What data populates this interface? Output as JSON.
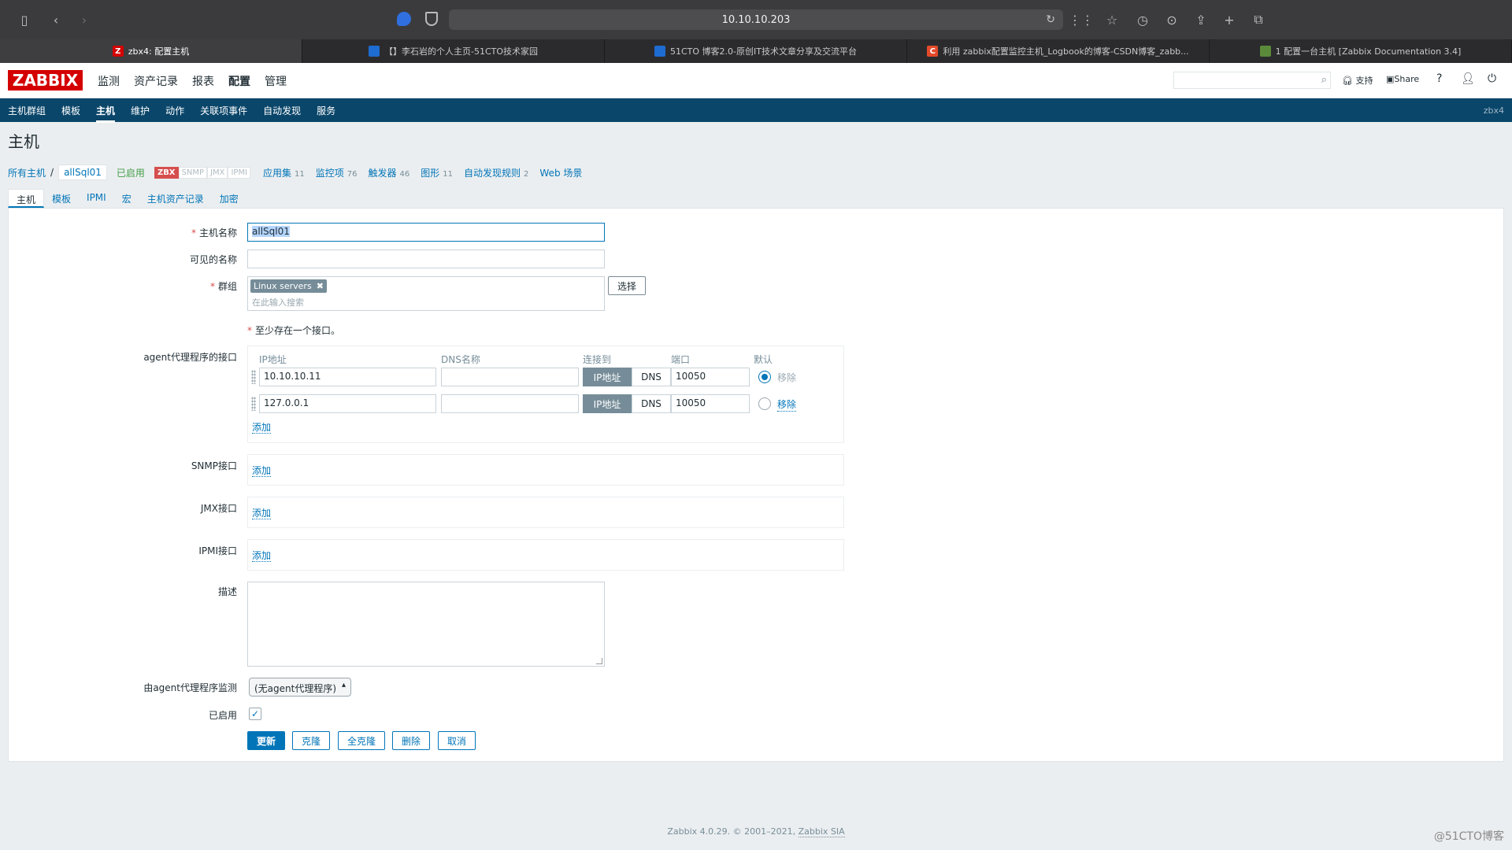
{
  "browser": {
    "url": "10.10.10.203",
    "tabs": [
      {
        "icon": "Z",
        "title": "zbx4: 配置主机",
        "color": "#d40000"
      },
      {
        "icon": "",
        "title": "【】李石岩的个人主页-51CTO技术家园",
        "color": "#1e6bd1"
      },
      {
        "icon": "",
        "title": "51CTO 博客2.0-原创IT技术文章分享及交流平台",
        "color": "#1e6bd1"
      },
      {
        "icon": "C",
        "title": "利用 zabbix配置监控主机_Logbook的博客-CSDN博客_zabb...",
        "color": "#e44a2a"
      },
      {
        "icon": "",
        "title": "1 配置一台主机 [Zabbix Documentation 3.4]",
        "color": "#5a8a3a"
      }
    ]
  },
  "header": {
    "logo": "ZABBIX",
    "menu": [
      "监测",
      "资产记录",
      "报表",
      "配置",
      "管理"
    ],
    "active_menu": "配置",
    "support": "支持",
    "share": "Share",
    "help": "?"
  },
  "subnav": {
    "items": [
      "主机群组",
      "模板",
      "主机",
      "维护",
      "动作",
      "关联项事件",
      "自动发现",
      "服务"
    ],
    "active": "主机",
    "server": "zbx4"
  },
  "page_title": "主机",
  "host_nav": {
    "all_hosts": "所有主机",
    "sep": "/",
    "host": "allSql01",
    "status": "已启用",
    "tags": [
      "ZBX",
      "SNMP",
      "JMX",
      "IPMI"
    ],
    "links": [
      {
        "label": "应用集",
        "count": "11"
      },
      {
        "label": "监控项",
        "count": "76"
      },
      {
        "label": "触发器",
        "count": "46"
      },
      {
        "label": "图形",
        "count": "11"
      },
      {
        "label": "自动发现规则",
        "count": "2"
      },
      {
        "label": "Web 场景",
        "count": ""
      }
    ]
  },
  "form_tabs": [
    "主机",
    "模板",
    "IPMI",
    "宏",
    "主机资产记录",
    "加密"
  ],
  "form": {
    "host_name_label": "主机名称",
    "host_name": "allSql01",
    "visible_name_label": "可见的名称",
    "visible_name": "",
    "groups_label": "群组",
    "group_chip": "Linux servers",
    "group_placeholder": "在此输入搜索",
    "select_button": "选择",
    "iface_note": "至少存在一个接口。",
    "agent_label": "agent代理程序的接口",
    "iface_headers": {
      "ip": "IP地址",
      "dns": "DNS名称",
      "connect": "连接到",
      "port": "端口",
      "default": "默认"
    },
    "interfaces": [
      {
        "ip": "10.10.10.11",
        "dns": "",
        "conn_ip": "IP地址",
        "conn_dns": "DNS",
        "port": "10050",
        "remove": "移除"
      },
      {
        "ip": "127.0.0.1",
        "dns": "",
        "conn_ip": "IP地址",
        "conn_dns": "DNS",
        "port": "10050",
        "remove": "移除"
      }
    ],
    "add": "添加",
    "snmp_label": "SNMP接口",
    "jmx_label": "JMX接口",
    "ipmi_label": "IPMI接口",
    "desc_label": "描述",
    "proxy_label": "由agent代理程序监测",
    "proxy_value": "(无agent代理程序)",
    "enabled_label": "已启用",
    "buttons": {
      "update": "更新",
      "clone": "克隆",
      "full_clone": "全克隆",
      "delete": "删除",
      "cancel": "取消"
    }
  },
  "footer": {
    "text": "Zabbix 4.0.29. © 2001–2021, ",
    "link": "Zabbix SIA"
  },
  "watermark": "@51CTO博客"
}
